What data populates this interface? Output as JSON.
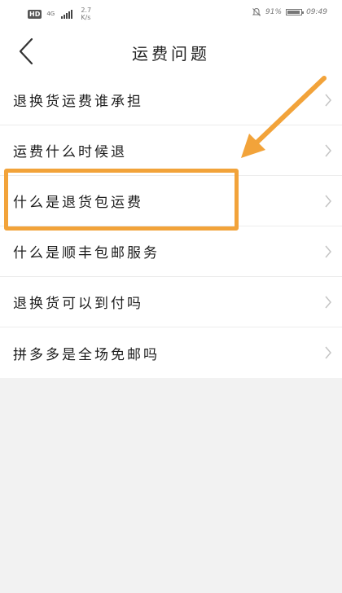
{
  "status_bar": {
    "hd": "HD",
    "net_type": "4G",
    "speed_value": "2.7",
    "speed_unit": "K/s",
    "battery_percent": "91%",
    "battery_level": 0.91,
    "time": "09:49"
  },
  "nav": {
    "title": "运费问题"
  },
  "faq_items": [
    {
      "label": "退换货运费谁承担"
    },
    {
      "label": "运费什么时候退"
    },
    {
      "label": "什么是退货包运费"
    },
    {
      "label": "什么是顺丰包邮服务"
    },
    {
      "label": "退换货可以到付吗"
    },
    {
      "label": "拼多多是全场免邮吗"
    }
  ],
  "colors": {
    "highlight": "#f2a33a",
    "background": "#f2f2f2",
    "surface": "#ffffff"
  },
  "annotations": {
    "highlighted_item_index": 2
  }
}
